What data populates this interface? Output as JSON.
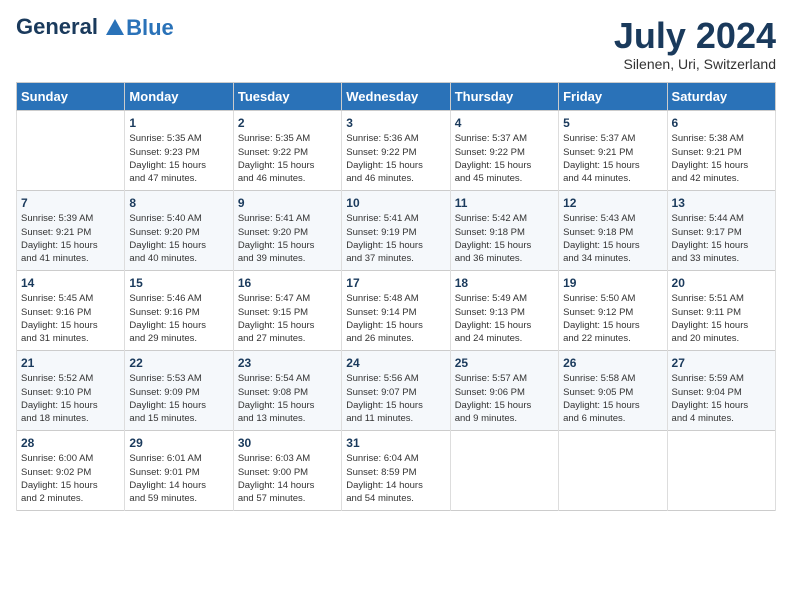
{
  "header": {
    "logo_line1": "General",
    "logo_line2": "Blue",
    "month": "July 2024",
    "location": "Silenen, Uri, Switzerland"
  },
  "weekdays": [
    "Sunday",
    "Monday",
    "Tuesday",
    "Wednesday",
    "Thursday",
    "Friday",
    "Saturday"
  ],
  "weeks": [
    [
      {
        "day": "",
        "content": ""
      },
      {
        "day": "1",
        "content": "Sunrise: 5:35 AM\nSunset: 9:23 PM\nDaylight: 15 hours\nand 47 minutes."
      },
      {
        "day": "2",
        "content": "Sunrise: 5:35 AM\nSunset: 9:22 PM\nDaylight: 15 hours\nand 46 minutes."
      },
      {
        "day": "3",
        "content": "Sunrise: 5:36 AM\nSunset: 9:22 PM\nDaylight: 15 hours\nand 46 minutes."
      },
      {
        "day": "4",
        "content": "Sunrise: 5:37 AM\nSunset: 9:22 PM\nDaylight: 15 hours\nand 45 minutes."
      },
      {
        "day": "5",
        "content": "Sunrise: 5:37 AM\nSunset: 9:21 PM\nDaylight: 15 hours\nand 44 minutes."
      },
      {
        "day": "6",
        "content": "Sunrise: 5:38 AM\nSunset: 9:21 PM\nDaylight: 15 hours\nand 42 minutes."
      }
    ],
    [
      {
        "day": "7",
        "content": "Sunrise: 5:39 AM\nSunset: 9:21 PM\nDaylight: 15 hours\nand 41 minutes."
      },
      {
        "day": "8",
        "content": "Sunrise: 5:40 AM\nSunset: 9:20 PM\nDaylight: 15 hours\nand 40 minutes."
      },
      {
        "day": "9",
        "content": "Sunrise: 5:41 AM\nSunset: 9:20 PM\nDaylight: 15 hours\nand 39 minutes."
      },
      {
        "day": "10",
        "content": "Sunrise: 5:41 AM\nSunset: 9:19 PM\nDaylight: 15 hours\nand 37 minutes."
      },
      {
        "day": "11",
        "content": "Sunrise: 5:42 AM\nSunset: 9:18 PM\nDaylight: 15 hours\nand 36 minutes."
      },
      {
        "day": "12",
        "content": "Sunrise: 5:43 AM\nSunset: 9:18 PM\nDaylight: 15 hours\nand 34 minutes."
      },
      {
        "day": "13",
        "content": "Sunrise: 5:44 AM\nSunset: 9:17 PM\nDaylight: 15 hours\nand 33 minutes."
      }
    ],
    [
      {
        "day": "14",
        "content": "Sunrise: 5:45 AM\nSunset: 9:16 PM\nDaylight: 15 hours\nand 31 minutes."
      },
      {
        "day": "15",
        "content": "Sunrise: 5:46 AM\nSunset: 9:16 PM\nDaylight: 15 hours\nand 29 minutes."
      },
      {
        "day": "16",
        "content": "Sunrise: 5:47 AM\nSunset: 9:15 PM\nDaylight: 15 hours\nand 27 minutes."
      },
      {
        "day": "17",
        "content": "Sunrise: 5:48 AM\nSunset: 9:14 PM\nDaylight: 15 hours\nand 26 minutes."
      },
      {
        "day": "18",
        "content": "Sunrise: 5:49 AM\nSunset: 9:13 PM\nDaylight: 15 hours\nand 24 minutes."
      },
      {
        "day": "19",
        "content": "Sunrise: 5:50 AM\nSunset: 9:12 PM\nDaylight: 15 hours\nand 22 minutes."
      },
      {
        "day": "20",
        "content": "Sunrise: 5:51 AM\nSunset: 9:11 PM\nDaylight: 15 hours\nand 20 minutes."
      }
    ],
    [
      {
        "day": "21",
        "content": "Sunrise: 5:52 AM\nSunset: 9:10 PM\nDaylight: 15 hours\nand 18 minutes."
      },
      {
        "day": "22",
        "content": "Sunrise: 5:53 AM\nSunset: 9:09 PM\nDaylight: 15 hours\nand 15 minutes."
      },
      {
        "day": "23",
        "content": "Sunrise: 5:54 AM\nSunset: 9:08 PM\nDaylight: 15 hours\nand 13 minutes."
      },
      {
        "day": "24",
        "content": "Sunrise: 5:56 AM\nSunset: 9:07 PM\nDaylight: 15 hours\nand 11 minutes."
      },
      {
        "day": "25",
        "content": "Sunrise: 5:57 AM\nSunset: 9:06 PM\nDaylight: 15 hours\nand 9 minutes."
      },
      {
        "day": "26",
        "content": "Sunrise: 5:58 AM\nSunset: 9:05 PM\nDaylight: 15 hours\nand 6 minutes."
      },
      {
        "day": "27",
        "content": "Sunrise: 5:59 AM\nSunset: 9:04 PM\nDaylight: 15 hours\nand 4 minutes."
      }
    ],
    [
      {
        "day": "28",
        "content": "Sunrise: 6:00 AM\nSunset: 9:02 PM\nDaylight: 15 hours\nand 2 minutes."
      },
      {
        "day": "29",
        "content": "Sunrise: 6:01 AM\nSunset: 9:01 PM\nDaylight: 14 hours\nand 59 minutes."
      },
      {
        "day": "30",
        "content": "Sunrise: 6:03 AM\nSunset: 9:00 PM\nDaylight: 14 hours\nand 57 minutes."
      },
      {
        "day": "31",
        "content": "Sunrise: 6:04 AM\nSunset: 8:59 PM\nDaylight: 14 hours\nand 54 minutes."
      },
      {
        "day": "",
        "content": ""
      },
      {
        "day": "",
        "content": ""
      },
      {
        "day": "",
        "content": ""
      }
    ]
  ]
}
